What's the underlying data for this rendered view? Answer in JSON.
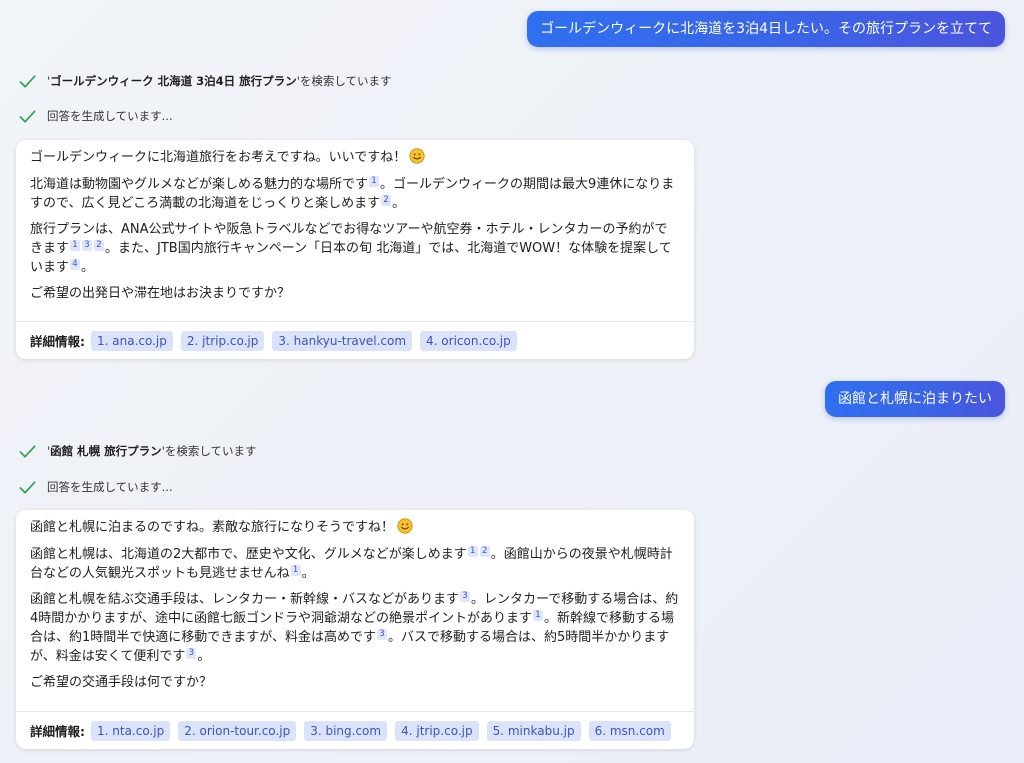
{
  "accent_color": "#2f6ff0",
  "check_color": "#2ea44f",
  "turns": [
    {
      "user_message": "ゴールデンウィークに北海道を3泊4日したい。その旅行プランを立てて",
      "search_query": "ゴールデンウィーク 北海道 3泊4日 旅行プラン",
      "search_suffix": " を検索しています",
      "generating_text": "回答を生成しています...",
      "response": {
        "p1": "ゴールデンウィークに北海道旅行をお考えですね。いいですね！",
        "p2a": "北海道は動物園やグルメなどが楽しめる魅力的な場所です",
        "p2b": "。ゴールデンウィークの期間は最大9連休になりますので、広く見どころ満載の北海道をじっくりと楽しめます",
        "p2c": "。",
        "p3a": "旅行プランは、ANA公式サイトや阪急トラベルなどでお得なツアーや航空券・ホテル・レンタカーの予約ができます",
        "p3b": "。また、JTB国内旅行キャンペーン「日本の旬 北海道」では、北海道でWOW！な体験を提案しています",
        "p3c": "。",
        "p4": "ご希望の出発日や滞在地はお決まりですか？"
      },
      "refs": {
        "p2_r1": "1",
        "p2_r2": "2",
        "p3_r1": "1",
        "p3_r2": "3",
        "p3_r3": "2",
        "p3_r4": "4"
      },
      "more_info_label": "詳細情報:",
      "sources": [
        "1. ana.co.jp",
        "2. jtrip.co.jp",
        "3. hankyu-travel.com",
        "4. oricon.co.jp"
      ]
    },
    {
      "user_message": "函館と札幌に泊まりたい",
      "search_query": "函館 札幌 旅行プラン",
      "search_suffix": " を検索しています",
      "generating_text": "回答を生成しています...",
      "response": {
        "p1": "函館と札幌に泊まるのですね。素敵な旅行になりそうですね！",
        "p2a": "函館と札幌は、北海道の2大都市で、歴史や文化、グルメなどが楽しめます",
        "p2b": "。函館山からの夜景や札幌時計台などの人気観光スポットも見逃せませんね",
        "p2c": "。",
        "p3a": "函館と札幌を結ぶ交通手段は、レンタカー・新幹線・バスなどがあります",
        "p3b": "。レンタカーで移動する場合は、約4時間かかりますが、途中に函館七飯ゴンドラや洞爺湖などの絶景ポイントがあります",
        "p3c": "。新幹線で移動する場合は、約1時間半で快適に移動できますが、料金は高めです",
        "p3d": "。バスで移動する場合は、約5時間半かかりますが、料金は安くて便利です",
        "p3e": "。",
        "p4": "ご希望の交通手段は何ですか？"
      },
      "refs": {
        "p2_r1": "1",
        "p2_r2": "2",
        "p2_r3": "1",
        "p3_r1": "3",
        "p3_r2": "1",
        "p3_r3": "3",
        "p3_r4": "3"
      },
      "more_info_label": "詳細情報:",
      "sources": [
        "1. nta.co.jp",
        "2. orion-tour.co.jp",
        "3. bing.com",
        "4. jtrip.co.jp",
        "5. minkabu.jp",
        "6. msn.com"
      ]
    }
  ]
}
